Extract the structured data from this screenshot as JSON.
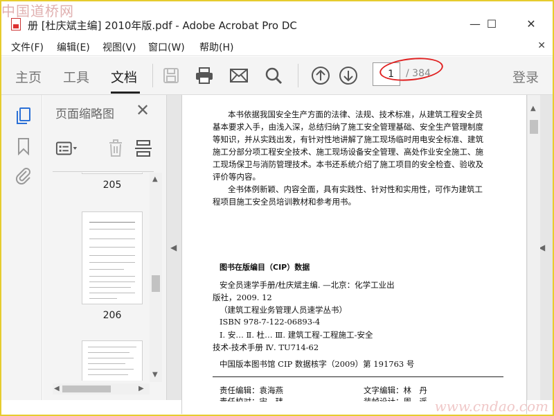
{
  "watermark": {
    "top": "中国道桥网",
    "bottom": "www.cndao.com"
  },
  "window": {
    "title": "册 [杜庆斌主编] 2010年版.pdf - Adobe Acrobat Pro DC",
    "minimize_glyph": "—",
    "maximize_glyph": "☐",
    "close_glyph": "✕"
  },
  "menu": {
    "items": [
      "文件(F)",
      "编辑(E)",
      "视图(V)",
      "窗口(W)",
      "帮助(H)"
    ],
    "close_glyph": "✕"
  },
  "toolbar": {
    "tabs": [
      {
        "label": "主页",
        "active": false
      },
      {
        "label": "工具",
        "active": false
      },
      {
        "label": "文档",
        "active": true
      }
    ],
    "icons": [
      "save-icon",
      "print-icon",
      "email-icon",
      "search-icon",
      "page-up-icon",
      "page-down-icon"
    ],
    "page_current": "1",
    "page_total": "/ 384",
    "login": "登录"
  },
  "left_rail": {
    "icons": [
      "page-thumbnails-icon",
      "bookmark-icon",
      "attachment-icon"
    ]
  },
  "thumbnail_panel": {
    "title": "页面缩略图",
    "close_glyph": "✕",
    "tools": [
      "page-options-icon",
      "delete-icon",
      "page-insert-icon"
    ],
    "pages": [
      {
        "label": "205"
      },
      {
        "label": "206"
      }
    ]
  },
  "document": {
    "intro_paragraph_1": [
      "本书依据我国安全生产方面的法律、法规、技术标准，从建筑工程安全员",
      "基本要求入手，由浅入深，总结归纳了施工安全管理基础、安全生产管理制度",
      "等知识，并从实践出发，有针对性地讲解了施工现场临时用电安全标准、建筑",
      "施工分部分项工程安全技术、施工现场设备安全管理、高处作业安全施工、施",
      "工现场保卫与消防管理技术。本书还系统介绍了施工项目的安全检查、验收及",
      "评价等内容。"
    ],
    "intro_paragraph_2": [
      "全书体例新颖、内容全面，具有实践性、针对性和实用性，可作为建筑工",
      "程项目施工安全员培训教材和参考用书。"
    ],
    "cip_title": "图书在版编目（CIP）数据",
    "cip_lines": [
      "安全员速学手册/杜庆斌主编. —北京：化学工业出",
      "版社，2009. 12",
      "（建筑工程业务管理人员速学丛书）",
      "ISBN 978-7-122-06893-4"
    ],
    "cip_class_lines": [
      "Ⅰ. 安…   Ⅱ. 杜…   Ⅲ. 建筑工程-工程施工-安全",
      "技术-技术手册   Ⅳ. TU714-62"
    ],
    "cip_number": "中国版本图书馆 CIP 数据核字（2009）第 191763 号",
    "editor_left": "责任编辑：袁海燕",
    "editor_right": "文字编辑：林　丹",
    "bottom_left_partial": "责任校对：宋　玮",
    "bottom_right_partial": "装帧设计：周　遥"
  },
  "colors": {
    "accent_blue": "#2a6fd6",
    "annotation_red": "#e02020",
    "frame_yellow": "#e6cc2e"
  }
}
